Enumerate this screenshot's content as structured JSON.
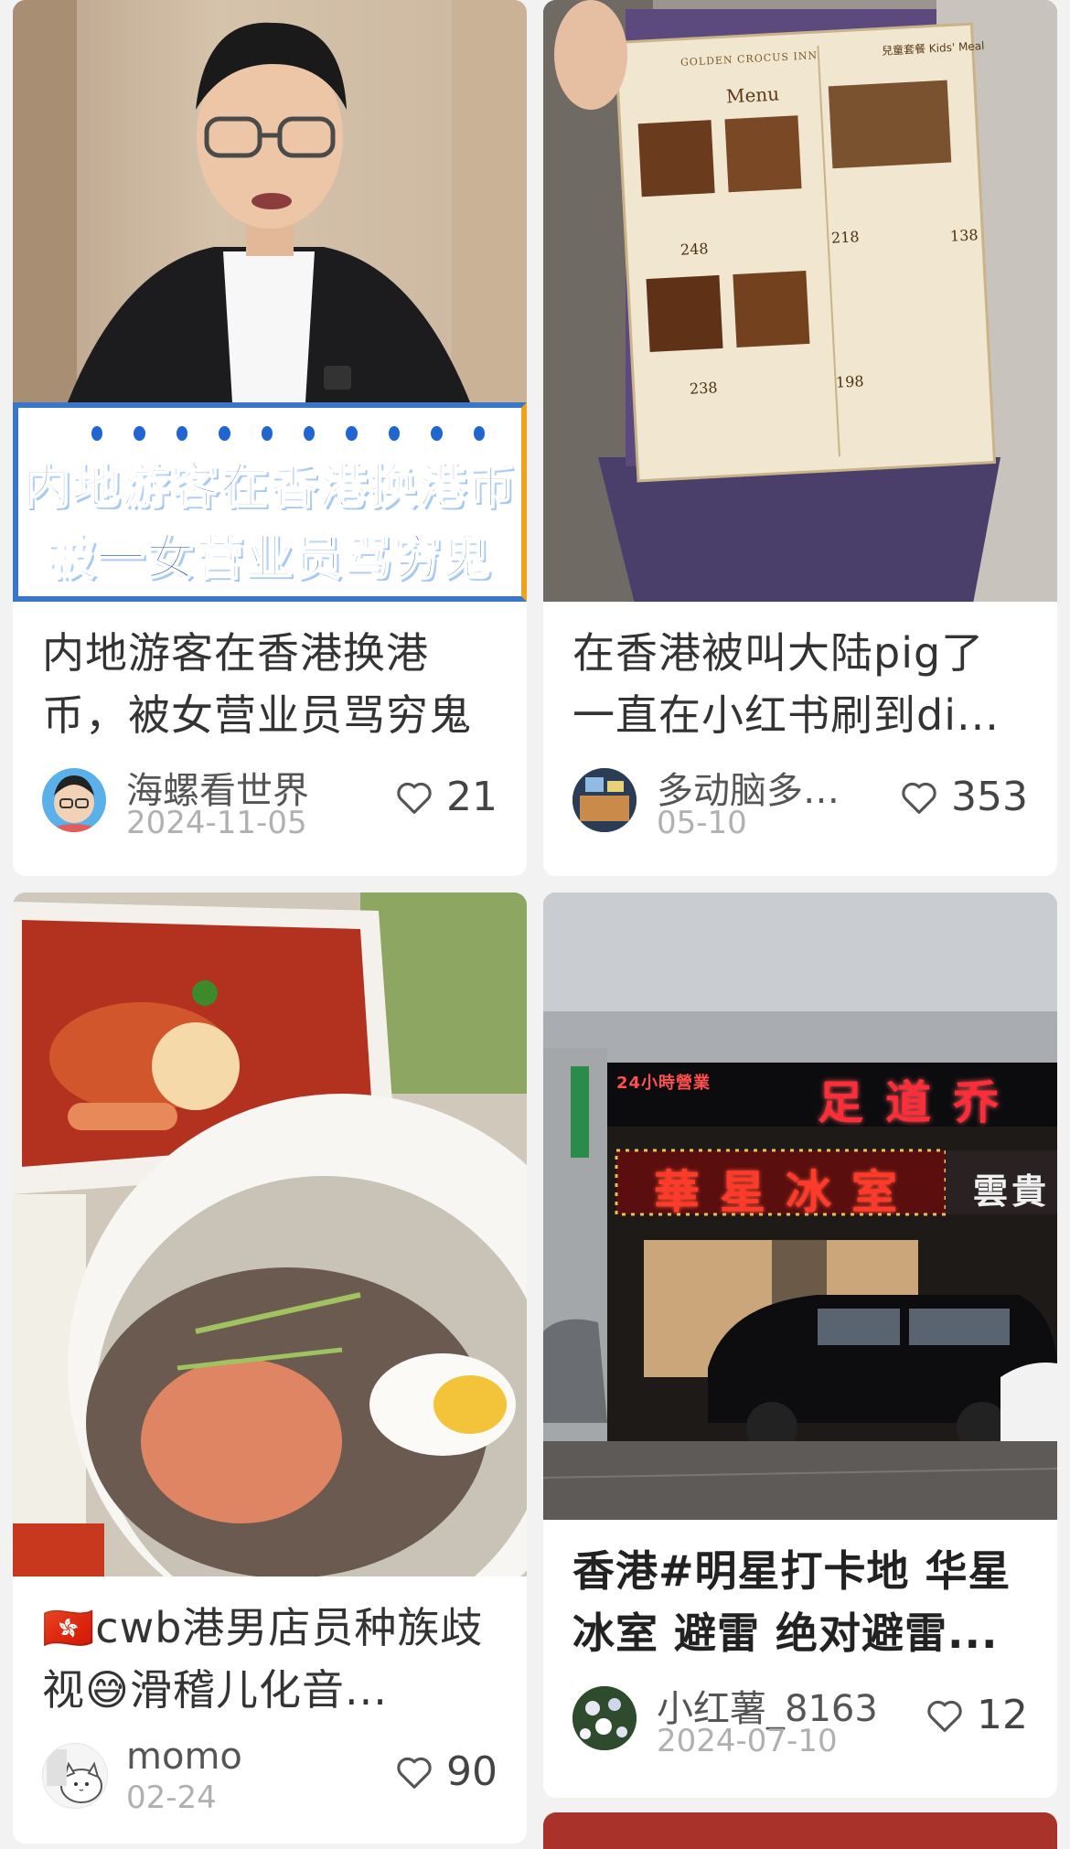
{
  "cards": [
    {
      "title": "内地游客在香港换港币，被女营业员骂穷鬼",
      "author": "海螺看世界",
      "date": "2024-11-05",
      "likes": "21",
      "banner_line1": "内地游客在香港换港币",
      "banner_line2": "被一女营业员骂穷鬼"
    },
    {
      "title": "在香港被叫大陆pig了 一直在小红书刷到di...",
      "author": "多动脑多…",
      "date": "05-10",
      "likes": "353",
      "menu_brand": "GOLDEN CROCUS INN",
      "menu_label": "Menu",
      "kids_meal": "兒童套餐 Kids' Meal",
      "price_1": "248",
      "price_2": "218",
      "price_3": "238",
      "price_4": "198",
      "price_kids": "138"
    },
    {
      "title_flag": "🇭🇰",
      "title": "cwb港男店员种族歧视😅滑稽儿化音...",
      "author": "momo",
      "date": "02-24",
      "likes": "90"
    },
    {
      "title": "香港#明星打卡地 华星冰室 避雷 绝对避雷...",
      "author": "小红薯_8163",
      "date": "2024-07-10",
      "likes": "12",
      "sign_top_left": "24小時營業",
      "sign_top_main": "足道乔",
      "sign_main": "華星冰室",
      "sign_right": "雲貴"
    }
  ],
  "colors": {
    "background": "#f2f2f3",
    "card": "#ffffff",
    "title": "#333333",
    "meta": "#b0b0b0"
  }
}
